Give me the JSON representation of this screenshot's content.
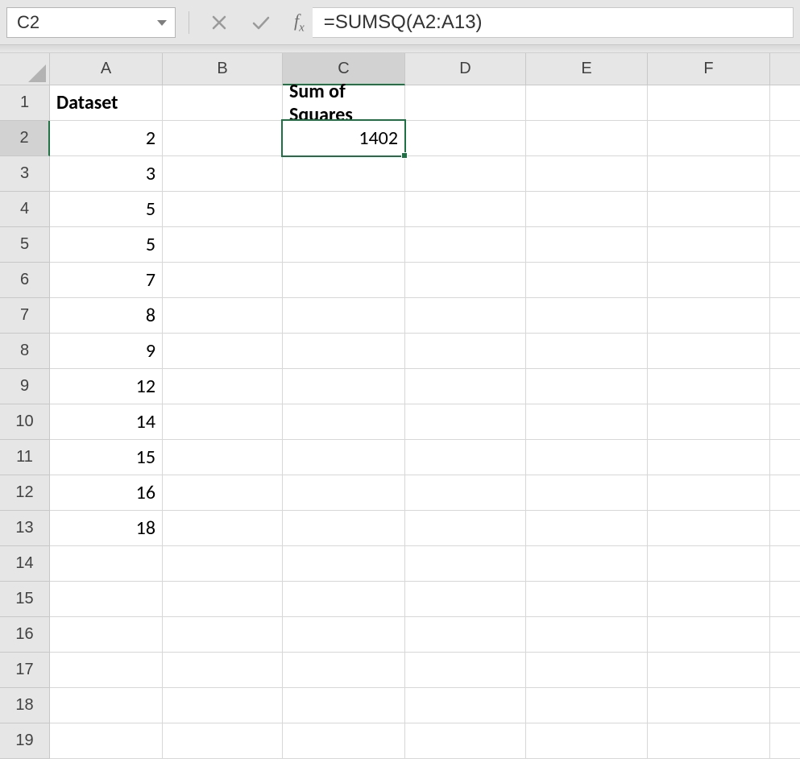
{
  "name_box": "C2",
  "formula": "=SUMSQ(A2:A13)",
  "columns": [
    "A",
    "B",
    "C",
    "D",
    "E",
    "F"
  ],
  "row_count": 19,
  "selected": {
    "col": "C",
    "row": 2
  },
  "headers": {
    "A1": "Dataset",
    "C1": "Sum of Squares"
  },
  "datasetA": {
    "2": "2",
    "3": "3",
    "4": "5",
    "5": "5",
    "6": "7",
    "7": "8",
    "8": "9",
    "9": "12",
    "10": "14",
    "11": "15",
    "12": "16",
    "13": "18"
  },
  "C2": "1402"
}
